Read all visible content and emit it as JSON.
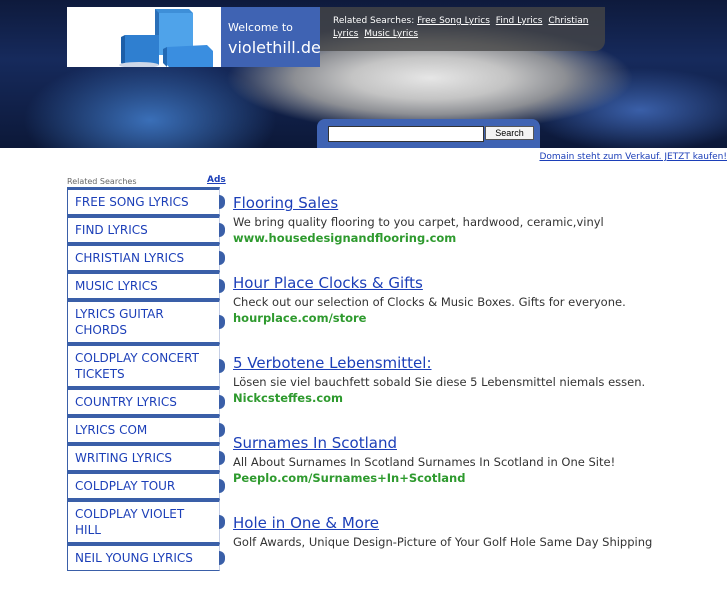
{
  "header": {
    "welcome_line": "Welcome to",
    "site_name": "violethill.de",
    "related_label": "Related Searches:",
    "related_links": [
      "Free Song Lyrics",
      "Find Lyrics",
      "Christian Lyrics",
      "Music Lyrics"
    ],
    "search_button": "Search",
    "search_value": "",
    "domain_sale": "Domain steht zum Verkauf. JETZT kaufen!"
  },
  "sidebar": {
    "label": "Related Searches",
    "ads_label": "Ads",
    "items": [
      "FREE SONG LYRICS",
      "FIND LYRICS",
      "CHRISTIAN LYRICS",
      "MUSIC LYRICS",
      "LYRICS GUITAR CHORDS",
      "COLDPLAY CONCERT TICKETS",
      "COUNTRY LYRICS",
      "LYRICS COM",
      "WRITING LYRICS",
      "COLDPLAY TOUR",
      "COLDPLAY VIOLET HILL",
      "NEIL YOUNG LYRICS"
    ]
  },
  "ads": [
    {
      "title": "Flooring Sales",
      "desc": "We bring quality flooring to you carpet, hardwood, ceramic,vinyl",
      "url": "www.housedesignandflooring.com"
    },
    {
      "title": "Hour Place Clocks & Gifts",
      "desc": "Check out our selection of Clocks & Music Boxes. Gifts for everyone.",
      "url": "hourplace.com/store"
    },
    {
      "title": "5 Verbotene Lebensmittel:",
      "desc": "Lösen sie viel bauchfett sobald Sie diese 5 Lebensmittel niemals essen.",
      "url": "Nickcsteffes.com"
    },
    {
      "title": "Surnames In Scotland",
      "desc": "All About Surnames In Scotland Surnames In Scotland in One Site!",
      "url": "Peeplo.com/Surnames+In+Scotland"
    },
    {
      "title": "Hole in One & More",
      "desc": "Golf Awards, Unique Design-Picture of Your Golf Hole Same Day Shipping",
      "url": ""
    }
  ],
  "colors": {
    "accent_blue": "#3f63b3",
    "link_blue": "#1c3fb8",
    "url_green": "#2e9a2e"
  }
}
